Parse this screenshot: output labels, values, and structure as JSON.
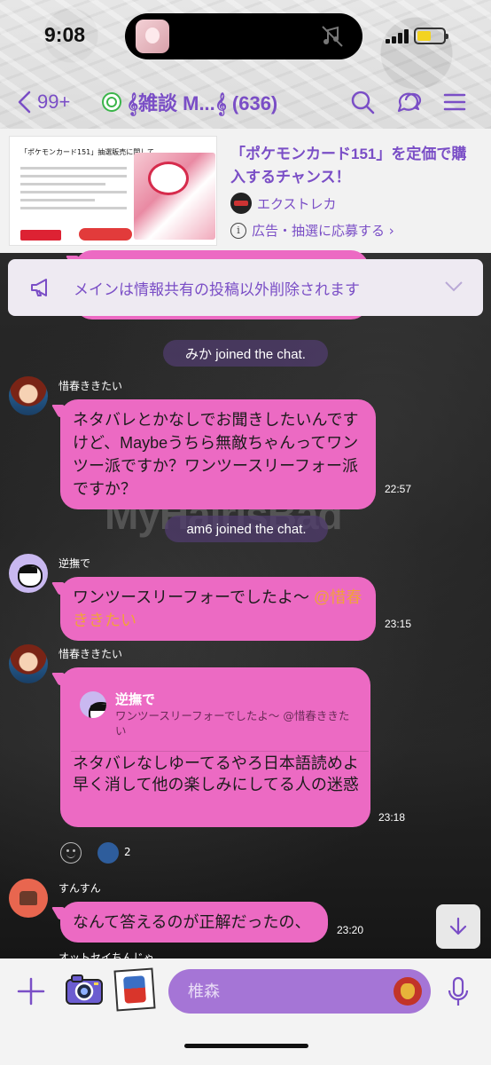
{
  "status_bar": {
    "time": "9:08",
    "battery_color": "#f3d320"
  },
  "header": {
    "back_count": "99+",
    "title": "𝄞雑談 M...𝄞 (636)",
    "accent_color": "#7a4ec6",
    "icons": [
      "back-chevron-icon",
      "search-icon",
      "chat-bubbles-icon",
      "menu-icon"
    ]
  },
  "ad": {
    "image_title": "「ポケモンカード151」抽選販売に関して",
    "headline": "「ポケモンカード151」を定価で購入するチャンス！",
    "brand": "エクストレカ",
    "note": "広告・抽選に応募する ›"
  },
  "pinned": {
    "text": "メインは情報共有の投稿以外削除されます"
  },
  "messages": [
    {
      "type": "system",
      "text": "みか joined the chat."
    },
    {
      "type": "chat",
      "user": "惜春ききたい",
      "text": "ネタバレとかなしでお聞きしたいんですけど、Maybeうちら無敵ちゃんってワンツー派ですか？ワンツースリーフォー派ですか？",
      "time": "22:57"
    },
    {
      "type": "system",
      "text": "am6 joined the chat."
    },
    {
      "type": "chat",
      "user": "逆撫で",
      "text": "ワンツースリーフォーでしたよ〜 ",
      "mention": "@惜春ききたい",
      "time": "23:15"
    },
    {
      "type": "chat",
      "user": "惜春ききたい",
      "reply_to": {
        "user": "逆撫で",
        "text": "ワンツースリーフォーでしたよ〜 @惜春ききたい"
      },
      "text": "ネタバレなしゆーてるやろ日本語読めよ早く消して他の楽しみにしてる人の迷惑",
      "time": "23:18",
      "reaction_count": "2"
    },
    {
      "type": "chat",
      "user": "すんすん",
      "text": "なんて答えるのが正解だったの、",
      "time": "23:20"
    },
    {
      "type": "chat",
      "user": "オットセイちんじゃ"
    }
  ],
  "background_watermark": "MyHairisBad",
  "input": {
    "placeholder": "椎森"
  },
  "colors": {
    "bubble": "#ec6ac3",
    "mention": "#f1a23a",
    "input_bar": "#a575d6"
  }
}
